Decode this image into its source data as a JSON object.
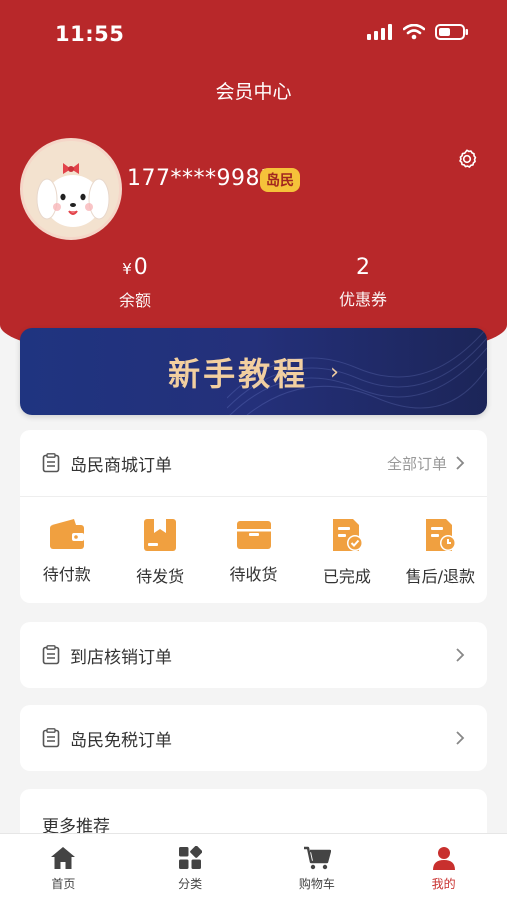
{
  "status_bar": {
    "time": "11:55"
  },
  "header": {
    "title": "会员中心"
  },
  "profile": {
    "phone": "177****9981",
    "badge": "岛民"
  },
  "stats": [
    {
      "currency": "¥",
      "value": "0",
      "label": "余额"
    },
    {
      "value": "2",
      "label": "优惠券"
    }
  ],
  "tutorial": {
    "label": "新手教程",
    "arrow": "›"
  },
  "mall_orders": {
    "title": "岛民商城订单",
    "all_label": "全部订单",
    "items": [
      {
        "label": "待付款",
        "icon": "wallet-icon"
      },
      {
        "label": "待发货",
        "icon": "box-icon"
      },
      {
        "label": "待收货",
        "icon": "package-icon"
      },
      {
        "label": "已完成",
        "icon": "completed-doc-icon"
      },
      {
        "label": "售后/退款",
        "icon": "refund-doc-icon"
      }
    ]
  },
  "store_orders": {
    "title": "到店核销订单"
  },
  "dutyfree_orders": {
    "title": "岛民免税订单"
  },
  "more": {
    "title": "更多推荐"
  },
  "tabbar": {
    "items": [
      {
        "label": "首页",
        "icon": "home-icon"
      },
      {
        "label": "分类",
        "icon": "category-icon"
      },
      {
        "label": "购物车",
        "icon": "cart-icon"
      },
      {
        "label": "我的",
        "icon": "user-icon",
        "active": true
      }
    ]
  },
  "colors": {
    "primary_red": "#b8282a",
    "accent_orange": "#f0a040",
    "badge_yellow": "#f5c23a",
    "tutorial_blue": "#1f3480",
    "tutorial_gold": "#f2cfa0"
  }
}
